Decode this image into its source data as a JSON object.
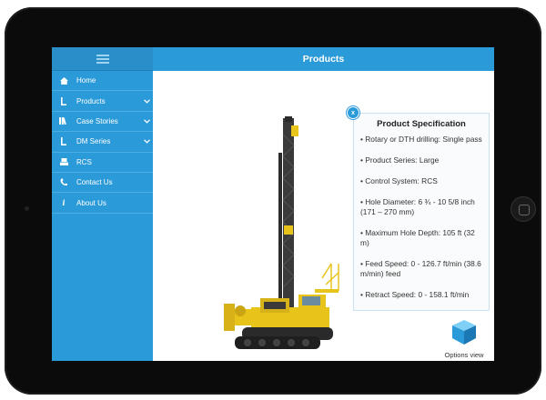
{
  "header": {
    "title": "Products"
  },
  "sidebar": {
    "items": [
      {
        "label": "Home",
        "icon": "home-icon"
      },
      {
        "label": "Products",
        "icon": "products-icon",
        "chevron": "⌄"
      },
      {
        "label": "Case Stories",
        "icon": "books-icon",
        "chevron": "⌄"
      },
      {
        "label": "DM Series",
        "icon": "drill-icon",
        "chevron": "⌄"
      },
      {
        "label": "RCS",
        "icon": "rcs-icon"
      },
      {
        "label": "Contact Us",
        "icon": "phone-icon"
      },
      {
        "label": "About Us",
        "icon": "info-icon"
      }
    ]
  },
  "spec": {
    "title": "Product Specification",
    "close_label": "x",
    "items": [
      "• Rotary or DTH drilling: Single pass",
      "• Product Series: Large",
      "• Control System: RCS",
      "• Hole Diameter: 6 ¾ - 10 5/8 inch (171 – 270 mm)",
      "• Maximum Hole Depth:  105 ft (32 m)",
      "• Feed Speed:  0 - 126.7 ft/min (38.6 m/min) feed",
      "• Retract Speed: 0 - 158.1 ft/min"
    ]
  },
  "options": {
    "label": "Options view",
    "icon": "cube-icon"
  },
  "colors": {
    "accent": "#2b9ad9",
    "machine": "#e8c41a"
  }
}
